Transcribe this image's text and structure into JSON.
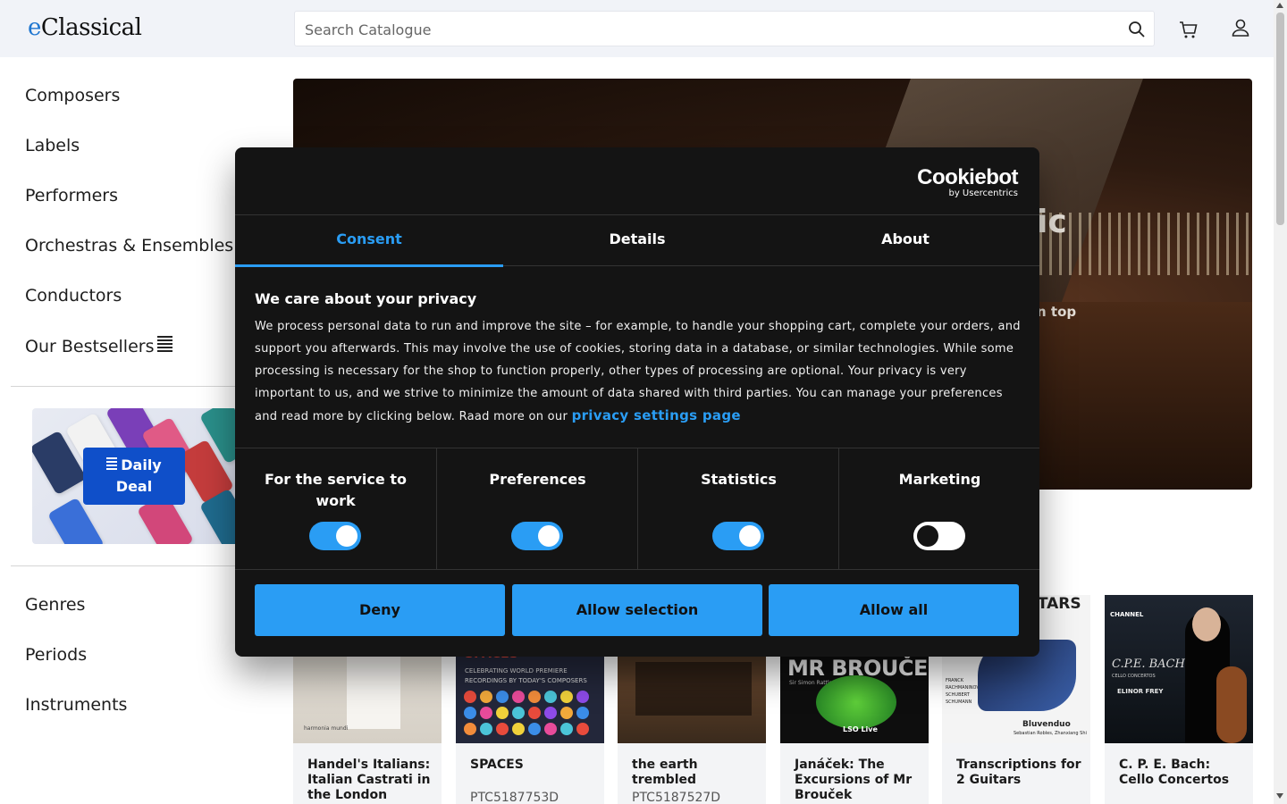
{
  "header": {
    "logo_e": "e",
    "logo_rest": "Classical",
    "search_placeholder": "Search Catalogue",
    "icons": [
      "search-icon",
      "cart-icon",
      "user-icon"
    ]
  },
  "sidebar": {
    "items": [
      "Composers",
      "Labels",
      "Performers",
      "Orchestras & Ensembles",
      "Conductors",
      "Our Bestsellers"
    ],
    "daily_deal": [
      "Daily",
      "Deal"
    ],
    "items2": [
      "Genres",
      "Periods",
      "Instruments"
    ]
  },
  "hero": {
    "title_fragment": "ic",
    "sub_fragment": "n top"
  },
  "products": [
    {
      "title": "Handel's Italians: Italian Castrati in the London",
      "code": ""
    },
    {
      "title": "SPACES",
      "code": "PTC5187753D"
    },
    {
      "title": "the earth trembled",
      "code": "PTC5187527D"
    },
    {
      "title": "Janáček: The Excursions of Mr Brouček",
      "code": ""
    },
    {
      "title": "Transcriptions for 2 Guitars",
      "code": ""
    },
    {
      "title": "C. P. E. Bach: Cello Concertos",
      "code": ""
    }
  ],
  "covers": {
    "c1_label": "harmonia mundi",
    "c2_title": "SPACES",
    "c2_sub": "CELEBRATING WORLD PREMIERE RECORDINGS BY TODAY'S COMPOSERS",
    "c4_title": "MR BROUČEK",
    "c4_artist": "Sir Simon Rattle",
    "c4_label": "LSO Live",
    "c5_top": "ONS TARS",
    "c5_composers": "FRANCK RACHMANINOV SCHUBERT SCHUMANN",
    "c5_title": "Bluvenduo",
    "c5_artists": "Sebastian Robles, Zhanxiang Shi",
    "c6_label": "CHANNEL",
    "c6_title": "C.P.E. BACH",
    "c6_sub": "CELLO CONCERTOS",
    "c6_artist": "ELINOR FREY"
  },
  "cookie": {
    "brand": "Cookiebot",
    "brand_sub": "by Usercentrics",
    "tabs": [
      "Consent",
      "Details",
      "About"
    ],
    "active_tab": "Consent",
    "heading": "We care about your privacy",
    "body": "We process personal data to run and improve the site – for example, to handle your shopping cart, complete your orders, and support you afterwards. This may involve the use of cookies, storing data in a database, or similar technologies. While some processing is necessary for the shop to function properly, other types of processing are optional. Your privacy is very important to us, and we strive to minimize the amount of data shared with third parties. You can manage your preferences and read more by clicking below. Raad more on our",
    "link": "privacy settings page",
    "toggles": [
      {
        "label": "For the service to work",
        "on": true
      },
      {
        "label": "Preferences",
        "on": true
      },
      {
        "label": "Statistics",
        "on": true
      },
      {
        "label": "Marketing",
        "on": false
      }
    ],
    "buttons": [
      "Deny",
      "Allow selection",
      "Allow all"
    ],
    "accent": "#2a9df4"
  }
}
